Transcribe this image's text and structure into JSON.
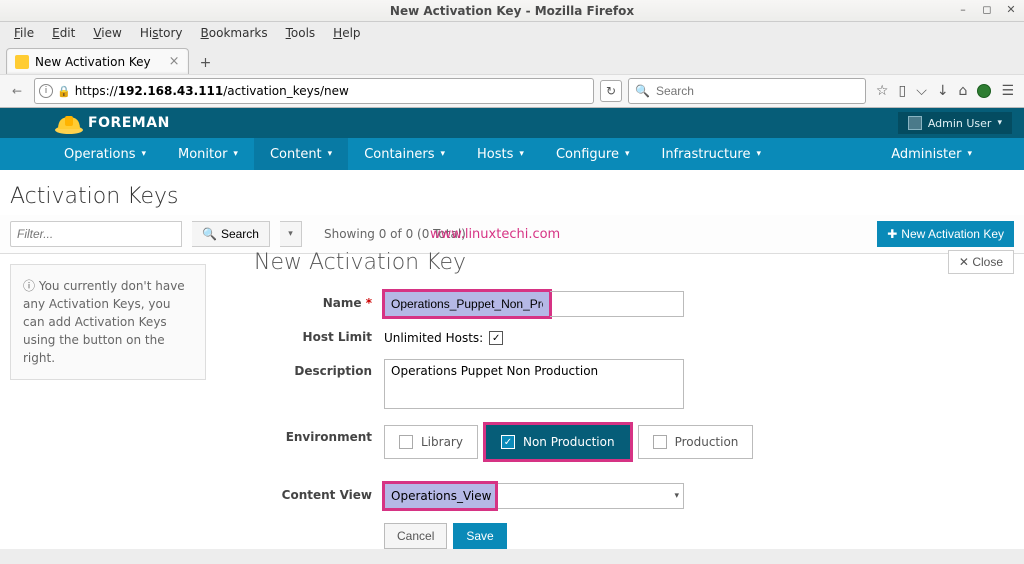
{
  "window": {
    "title": "New Activation Key - Mozilla Firefox"
  },
  "ff_menu": [
    "File",
    "Edit",
    "View",
    "History",
    "Bookmarks",
    "Tools",
    "Help"
  ],
  "tab": {
    "label": "New Activation Key"
  },
  "url": {
    "host": "192.168.43.111",
    "path": "/activation_keys/new",
    "scheme": "https://"
  },
  "search": {
    "placeholder": "Search"
  },
  "foreman": {
    "brand": "FOREMAN",
    "user": "Admin User",
    "nav": [
      "Operations",
      "Monitor",
      "Content",
      "Containers",
      "Hosts",
      "Configure",
      "Infrastructure"
    ],
    "nav_right": "Administer"
  },
  "page": {
    "title": "Activation Keys",
    "filter_placeholder": "Filter...",
    "search_btn": "Search",
    "showing": "Showing 0 of 0 (0 Total)",
    "watermark": "www.linuxtechi.com",
    "new_btn": "New Activation Key",
    "info_line1": "You currently don't have any Activation Keys, you can add Activation Keys using the button on the right.",
    "form_heading": "New Activation Key",
    "close_btn": "Close"
  },
  "form": {
    "name_label": "Name",
    "name_value": "Operations_Puppet_Non_Prod",
    "hostlimit_label": "Host Limit",
    "hostlimit_text": "Unlimited Hosts:",
    "description_label": "Description",
    "description_value": "Operations Puppet Non Production",
    "environment_label": "Environment",
    "env_library": "Library",
    "env_nonprod": "Non Production",
    "env_prod": "Production",
    "contentview_label": "Content View",
    "contentview_value": "Operations_View",
    "cancel": "Cancel",
    "save": "Save"
  }
}
